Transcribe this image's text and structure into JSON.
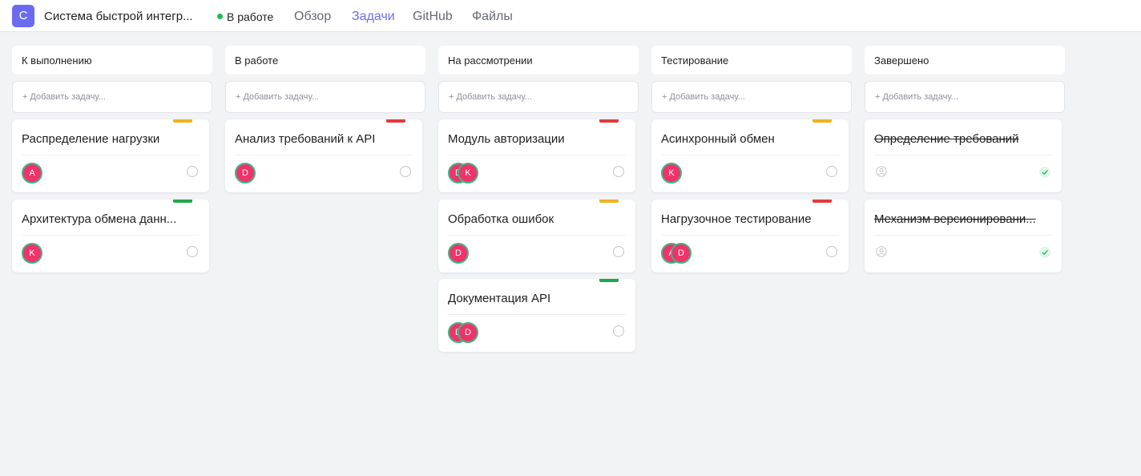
{
  "header": {
    "logo_letter": "С",
    "project_title": "Система быстрой интегр...",
    "status_label": "В работе",
    "status_color": "#18c04d",
    "tabs": [
      {
        "label": "Обзор",
        "active": false
      },
      {
        "label": "Задачи",
        "active": true
      },
      {
        "label": "GitHub",
        "active": false
      },
      {
        "label": "Файлы",
        "active": false
      }
    ]
  },
  "colors": {
    "accent": "#6b6bf0",
    "priority_high": "#e5383b",
    "priority_medium": "#f2b21b",
    "priority_low": "#1fa84a",
    "avatar_fill": "#f0336a",
    "avatar_ring": "#42b583"
  },
  "add_task_placeholder": "+ Добавить задачу...",
  "columns": [
    {
      "title": "К выполнению",
      "cards": [
        {
          "title": "Распределение нагрузки",
          "priority": "medium",
          "assignees": [
            "A"
          ],
          "done": false
        },
        {
          "title": "Архитектура обмена данн...",
          "priority": "low",
          "assignees": [
            "K"
          ],
          "done": false
        }
      ]
    },
    {
      "title": "В работе",
      "cards": [
        {
          "title": "Анализ требований к API",
          "priority": "high",
          "assignees": [
            "D"
          ],
          "done": false
        }
      ]
    },
    {
      "title": "На рассмотрении",
      "cards": [
        {
          "title": "Модуль авторизации",
          "priority": "high",
          "assignees": [
            "D",
            "K"
          ],
          "done": false
        },
        {
          "title": "Обработка ошибок",
          "priority": "medium",
          "assignees": [
            "D"
          ],
          "done": false
        },
        {
          "title": "Документация API",
          "priority": "low",
          "assignees": [
            "D",
            "D"
          ],
          "done": false
        }
      ]
    },
    {
      "title": "Тестирование",
      "cards": [
        {
          "title": "Асинхронный обмен",
          "priority": "medium",
          "assignees": [
            "K"
          ],
          "done": false
        },
        {
          "title": "Нагрузочное тестирование",
          "priority": "high",
          "assignees": [
            "A",
            "D"
          ],
          "done": false
        }
      ]
    },
    {
      "title": "Завершено",
      "cards": [
        {
          "title": "Определение требований",
          "priority": "none",
          "assignees": [],
          "done": true
        },
        {
          "title": "Механизм версионировани...",
          "priority": "none",
          "assignees": [],
          "done": true
        }
      ]
    }
  ]
}
